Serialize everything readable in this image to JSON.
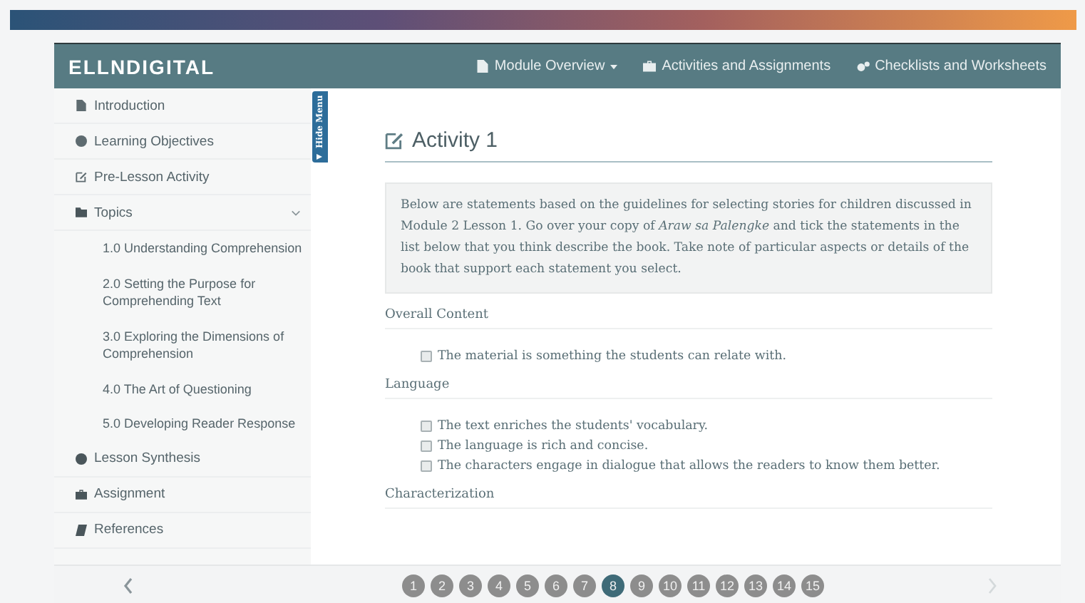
{
  "header": {
    "logo": "ELLNDIGITAL",
    "nav": [
      {
        "label": "Module Overview",
        "dropdown": true
      },
      {
        "label": "Activities and Assignments",
        "dropdown": false
      },
      {
        "label": "Checklists and Worksheets",
        "dropdown": false
      }
    ]
  },
  "sidebar": {
    "toggle": "Hide Menu",
    "items": [
      {
        "label": "Introduction"
      },
      {
        "label": "Learning Objectives"
      },
      {
        "label": "Pre-Lesson Activity"
      },
      {
        "label": "Topics",
        "expanded": true,
        "children": [
          {
            "label": "1.0 Understanding Comprehension"
          },
          {
            "label": "2.0 Setting the Purpose for Comprehending Text"
          },
          {
            "label": "3.0 Exploring the Dimensions of Comprehension"
          },
          {
            "label": "4.0 The Art of Questioning"
          },
          {
            "label": "5.0 Developing Reader Response"
          }
        ]
      },
      {
        "label": "Lesson Synthesis"
      },
      {
        "label": "Assignment"
      },
      {
        "label": "References"
      }
    ]
  },
  "content": {
    "title": "Activity 1",
    "instructions": "Below are statements based on the guidelines for selecting stories for children discussed in Module 2 Lesson 1. Go over your copy of *Araw sa Palengke* and tick the statements in the list below that you think describe the book. Take note of particular aspects or details of the book that support each statement you select.",
    "sections": [
      {
        "heading": "Overall Content",
        "statements": [
          {
            "text": "The material is something the students can relate with.",
            "checked": false
          }
        ]
      },
      {
        "heading": "Language",
        "statements": [
          {
            "text": "The text enriches the students' vocabulary.",
            "checked": false
          },
          {
            "text": "The language is rich and concise.",
            "checked": false
          },
          {
            "text": "The characters engage in dialogue that allows the readers to know them better.",
            "checked": false
          }
        ]
      },
      {
        "heading": "Characterization"
      }
    ]
  },
  "pager": {
    "pages": [
      {
        "label": "1",
        "selected": false
      },
      {
        "label": "2",
        "selected": false
      },
      {
        "label": "3",
        "selected": false
      },
      {
        "label": "4",
        "selected": false
      },
      {
        "label": "5",
        "selected": false
      },
      {
        "label": "6",
        "selected": false
      },
      {
        "label": "7",
        "selected": false
      },
      {
        "label": "8",
        "selected": true
      },
      {
        "label": "9",
        "selected": false
      },
      {
        "label": "10",
        "selected": false
      },
      {
        "label": "11",
        "selected": false
      },
      {
        "label": "12",
        "selected": false
      },
      {
        "label": "13",
        "selected": false
      },
      {
        "label": "14",
        "selected": false
      },
      {
        "label": "15",
        "selected": false
      }
    ]
  }
}
